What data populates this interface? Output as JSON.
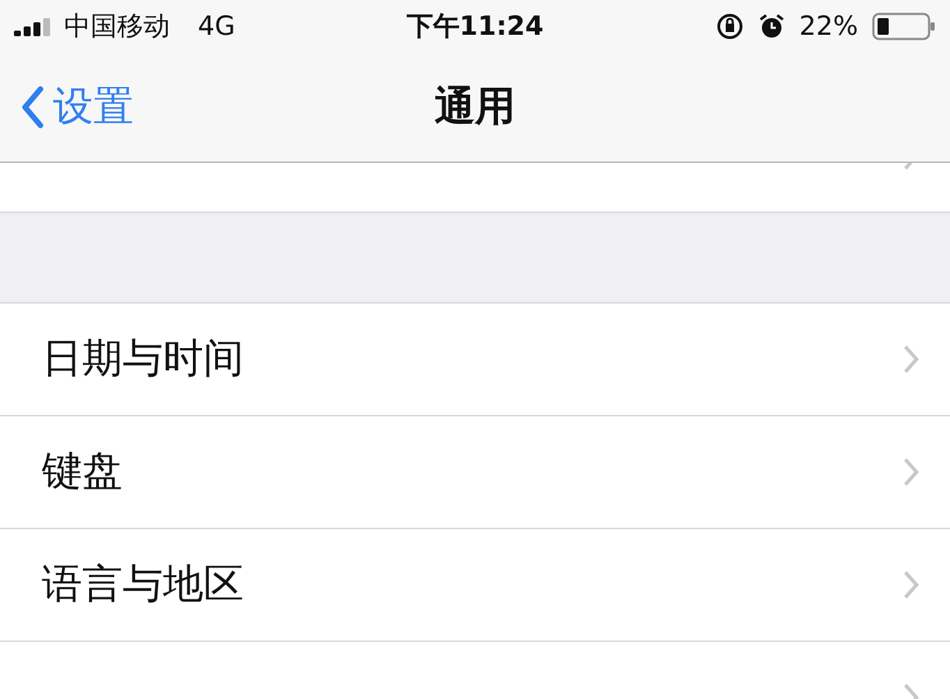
{
  "status_bar": {
    "carrier": "中国移动",
    "network": "4G",
    "time": "下午11:24",
    "battery": "22%"
  },
  "nav_bar": {
    "back": "设置",
    "title": "通用"
  },
  "groups": [
    {
      "rows": [
        {
          "chevron": true
        }
      ]
    },
    {
      "rows": [
        {
          "label": "日期与时间",
          "chevron": true
        },
        {
          "label": "键盘",
          "chevron": true
        },
        {
          "label": "语言与地区",
          "chevron": true
        },
        {
          "chevron": true
        }
      ]
    }
  ]
}
